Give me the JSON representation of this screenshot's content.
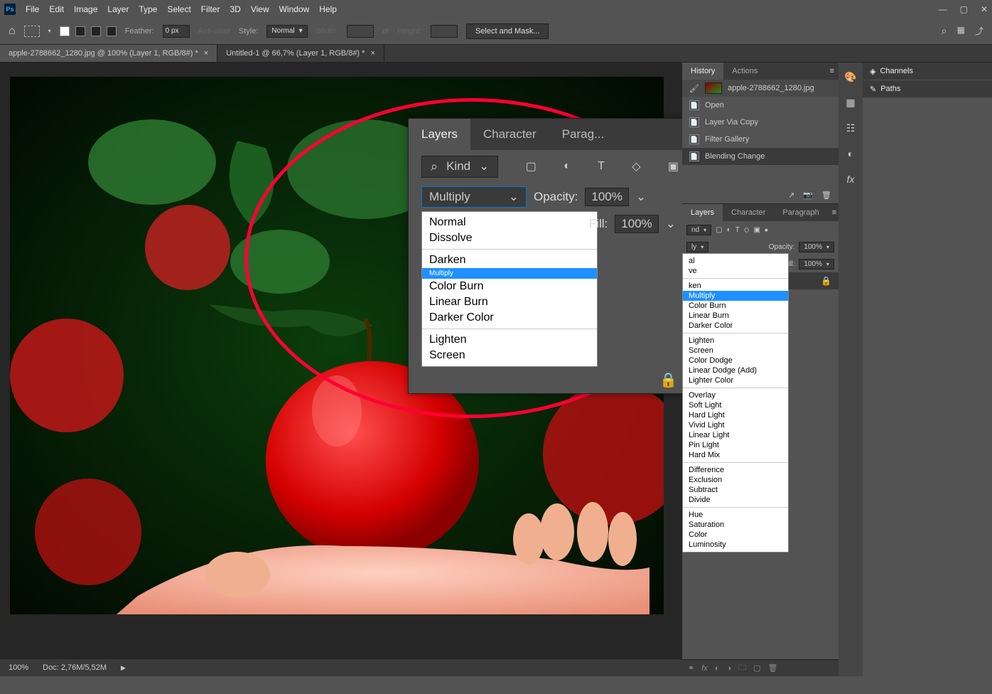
{
  "menubar": {
    "items": [
      "File",
      "Edit",
      "Image",
      "Layer",
      "Type",
      "Select",
      "Filter",
      "3D",
      "View",
      "Window",
      "Help"
    ]
  },
  "win_controls": {
    "minimize": "—",
    "maximize": "▢",
    "close": "✕"
  },
  "options": {
    "feather_label": "Feather:",
    "feather_val": "0 px",
    "antialias_label": "Anti-alias",
    "style_label": "Style:",
    "style_val": "Normal",
    "width_label": "Width:",
    "height_label": "Height:",
    "mask_btn": "Select and Mask..."
  },
  "tabs": [
    {
      "label": "apple-2788662_1280.jpg @ 100% (Layer 1, RGB/8#) *"
    },
    {
      "label": "Untitled-1 @ 66,7% (Layer 1, RGB/8#) *"
    }
  ],
  "overlay": {
    "tabs": [
      "Layers",
      "Character",
      "Parag..."
    ],
    "kind": "Kind",
    "blend": "Multiply",
    "opacity_label": "Opacity:",
    "opacity_val": "100%",
    "fill_label": "Fill:",
    "fill_val": "100%",
    "groups": [
      [
        "Normal",
        "Dissolve"
      ],
      [
        "Darken",
        "Multiply",
        "Color Burn",
        "Linear Burn",
        "Darker Color"
      ],
      [
        "Lighten",
        "Screen"
      ]
    ],
    "selected": "Multiply"
  },
  "history_panel": {
    "tabs": [
      "History",
      "Actions"
    ],
    "source": "apple-2788662_1280.jpg",
    "states": [
      "Open",
      "Layer Via Copy",
      "Filter Gallery",
      "Blending Change"
    ]
  },
  "layers_panel": {
    "tabs": [
      "Layers",
      "Character",
      "Paragraph"
    ],
    "kind": "Kind",
    "blend_partial": "ly",
    "opacity_label": "Opacity:",
    "opacity_val": "100%",
    "fill_label": "Fill:",
    "fill_val": "100%"
  },
  "blend_full": {
    "groups": [
      [
        "Normal",
        "Dissolve"
      ],
      [
        "Darken",
        "Multiply",
        "Color Burn",
        "Linear Burn",
        "Darker Color"
      ],
      [
        "Lighten",
        "Screen",
        "Color Dodge",
        "Linear Dodge (Add)",
        "Lighter Color"
      ],
      [
        "Overlay",
        "Soft Light",
        "Hard Light",
        "Vivid Light",
        "Linear Light",
        "Pin Light",
        "Hard Mix"
      ],
      [
        "Difference",
        "Exclusion",
        "Subtract",
        "Divide"
      ],
      [
        "Hue",
        "Saturation",
        "Color",
        "Luminosity"
      ]
    ],
    "selected": "Multiply",
    "partial_top": [
      "al",
      "ve"
    ],
    "partial_top2": [
      "ken"
    ]
  },
  "far_right": {
    "channels": "Channels",
    "paths": "Paths"
  },
  "status": {
    "zoom": "100%",
    "doc": "Doc: 2,76M/5,52M"
  },
  "logo": "Ps"
}
